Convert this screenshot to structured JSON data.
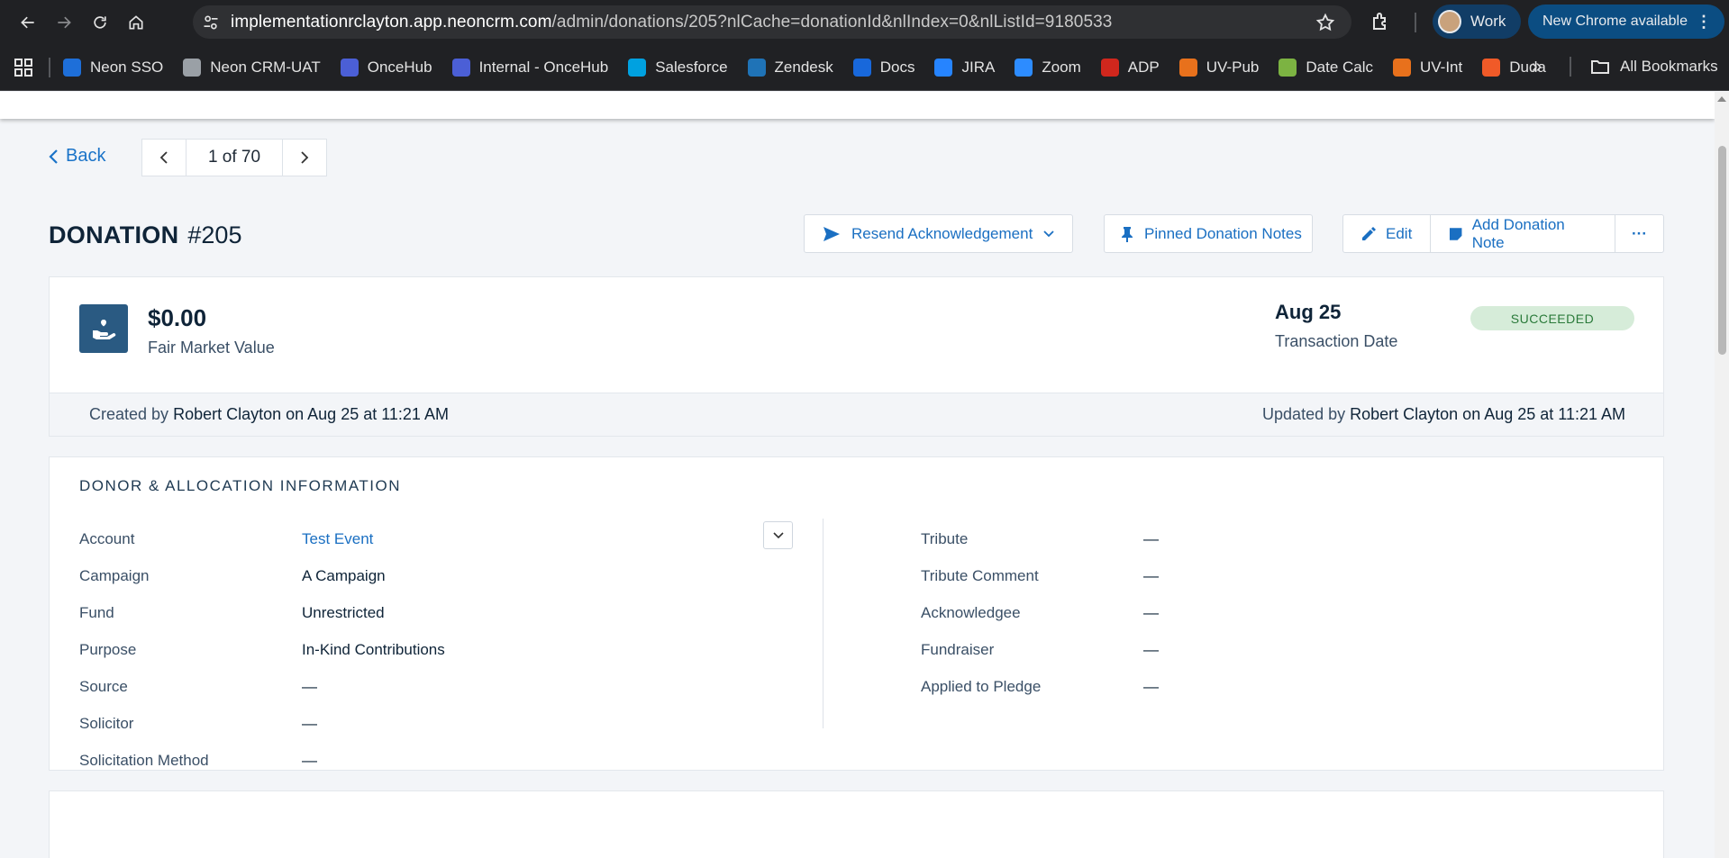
{
  "browser": {
    "url_host": "implementationrclayton.app.neoncrm.com",
    "url_path": "/admin/donations/205?nlCache=donationId&nlIndex=0&nlListId=9180533",
    "profile_label": "Work",
    "update_label": "New Chrome available",
    "all_bookmarks_label": "All Bookmarks",
    "bookmarks": [
      {
        "label": "Neon SSO",
        "color": "#1e6fd9"
      },
      {
        "label": "Neon CRM-UAT",
        "color": "#9aa0a6"
      },
      {
        "label": "OnceHub",
        "color": "#4b5fd6"
      },
      {
        "label": "Internal - OnceHub",
        "color": "#4b5fd6"
      },
      {
        "label": "Salesforce",
        "color": "#00a1e0"
      },
      {
        "label": "Zendesk",
        "color": "#1f73b7"
      },
      {
        "label": "Docs",
        "color": "#1868db"
      },
      {
        "label": "JIRA",
        "color": "#2684ff"
      },
      {
        "label": "Zoom",
        "color": "#2d8cff"
      },
      {
        "label": "ADP",
        "color": "#d0271d"
      },
      {
        "label": "UV-Pub",
        "color": "#e8711c"
      },
      {
        "label": "Date Calc",
        "color": "#7cb342"
      },
      {
        "label": "UV-Int",
        "color": "#e8711c"
      },
      {
        "label": "Duda",
        "color": "#f05a28"
      }
    ]
  },
  "page": {
    "back_label": "Back",
    "pager_text": "1 of 70",
    "title_type": "DONATION",
    "title_number": "#205",
    "actions": {
      "resend": "Resend Acknowledgement",
      "pinned": "Pinned Donation Notes",
      "edit": "Edit",
      "add_note": "Add Donation Note",
      "more": "···"
    },
    "summary": {
      "amount": "$0.00",
      "amount_label": "Fair Market Value",
      "date": "Aug 25",
      "date_label": "Transaction Date",
      "status": "SUCCEEDED",
      "created_prefix": "Created by",
      "created_text": "Robert Clayton on Aug 25 at 11:21 AM",
      "updated_prefix": "Updated by",
      "updated_text": "Robert Clayton on Aug 25 at 11:21 AM"
    },
    "info": {
      "title": "DONOR & ALLOCATION INFORMATION",
      "left": [
        {
          "label": "Account",
          "value": "Test Event"
        },
        {
          "label": "Campaign",
          "value": "A Campaign"
        },
        {
          "label": "Fund",
          "value": "Unrestricted"
        },
        {
          "label": "Purpose",
          "value": "In-Kind Contributions"
        },
        {
          "label": "Source",
          "value": "—"
        },
        {
          "label": "Solicitor",
          "value": "—"
        },
        {
          "label": "Solicitation Method",
          "value": "—"
        }
      ],
      "right": [
        {
          "label": "Tribute",
          "value": "—"
        },
        {
          "label": "Tribute Comment",
          "value": "—"
        },
        {
          "label": "Acknowledgee",
          "value": "—"
        },
        {
          "label": "Fundraiser",
          "value": "—"
        },
        {
          "label": "Applied to Pledge",
          "value": "—"
        }
      ]
    }
  },
  "colors": {
    "accent": "#1a6fc2",
    "status_bg": "#d6ecd9",
    "status_text": "#2a7a3a",
    "icon_bg": "#2a5a82"
  }
}
